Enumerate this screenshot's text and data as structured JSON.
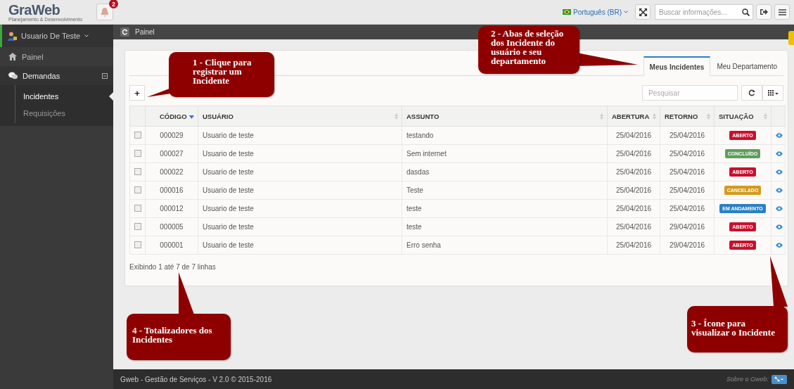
{
  "header": {
    "logo": "GraWeb",
    "logo_tagline": "Planejamento & Desenvolvimento",
    "notifications": "2",
    "language": "Português (BR)",
    "search": {
      "placeholder": "Buscar informações..."
    }
  },
  "sidebar": {
    "user": "Usuario De Teste",
    "items": [
      {
        "label": "Painel",
        "expanded": false
      },
      {
        "label": "Demandas",
        "expanded": true,
        "children": [
          {
            "label": "Incidentes",
            "selected": true
          },
          {
            "label": "Requisições",
            "selected": false
          }
        ]
      }
    ]
  },
  "breadcrumb": "Painel",
  "tabs": [
    {
      "label": "Meus Incidentes",
      "selected": true
    },
    {
      "label": "Meu Departamento",
      "selected": false
    }
  ],
  "toolbar": {
    "add": "+",
    "search_placeholder": "Pesquisar"
  },
  "table": {
    "columns": [
      {
        "label": "CÓDIGO",
        "sorted": true
      },
      {
        "label": "USUÁRIO",
        "sorted": false
      },
      {
        "label": "ASSUNTO",
        "sorted": false
      },
      {
        "label": "ABERTURA",
        "sorted": false
      },
      {
        "label": "RETORNO",
        "sorted": false
      },
      {
        "label": "SITUAÇÃO",
        "sorted": false
      }
    ],
    "rows": [
      {
        "checked": false,
        "codigo": "000029",
        "usuario": "Usuario de teste",
        "assunto": "testando",
        "abertura": "25/04/2016",
        "retorno": "25/04/2016",
        "situacao": "ABERTO",
        "color": "#c8102e"
      },
      {
        "checked": false,
        "codigo": "000027",
        "usuario": "Usuario de teste",
        "assunto": "Sem internet",
        "abertura": "25/04/2016",
        "retorno": "25/04/2016",
        "situacao": "CONCLUÍDO",
        "color": "#5e9e5a"
      },
      {
        "checked": false,
        "codigo": "000022",
        "usuario": "Usuario de teste",
        "assunto": "dasdas",
        "abertura": "25/04/2016",
        "retorno": "25/04/2016",
        "situacao": "ABERTO",
        "color": "#c8102e"
      },
      {
        "checked": false,
        "codigo": "000016",
        "usuario": "Usuario de teste",
        "assunto": "Teste",
        "abertura": "25/04/2016",
        "retorno": "25/04/2016",
        "situacao": "CANCELADO",
        "color": "#d49a1a"
      },
      {
        "checked": false,
        "codigo": "000012",
        "usuario": "Usuario de teste",
        "assunto": "teste",
        "abertura": "25/04/2016",
        "retorno": "25/04/2016",
        "situacao": "EM ANDAMENTO",
        "color": "#2a7fc6"
      },
      {
        "checked": false,
        "codigo": "000005",
        "usuario": "Usuario de teste",
        "assunto": "teste",
        "abertura": "25/04/2016",
        "retorno": "29/04/2016",
        "situacao": "ABERTO",
        "color": "#c8102e"
      },
      {
        "checked": false,
        "codigo": "000001",
        "usuario": "Usuario de teste",
        "assunto": "Erro senha",
        "abertura": "25/04/2016",
        "retorno": "29/04/2016",
        "situacao": "ABERTO",
        "color": "#c8102e"
      }
    ]
  },
  "pagination": "Exibindo 1 até 7 de 7 linhas",
  "footer": {
    "text": "Gweb - Gestão de Serviços - V 2.0 © 2015-2016",
    "about": "Sobre o Gweb:"
  },
  "callouts": [
    {
      "text": "1 - Clique para registrar um Incidente"
    },
    {
      "text": "2 - Abas de seleção dos Incidente do usuário e seu departamento"
    },
    {
      "text": "3 - Ícone para visualizar o Incidente"
    },
    {
      "text": "4 - Totalizadores dos Incidentes"
    }
  ]
}
